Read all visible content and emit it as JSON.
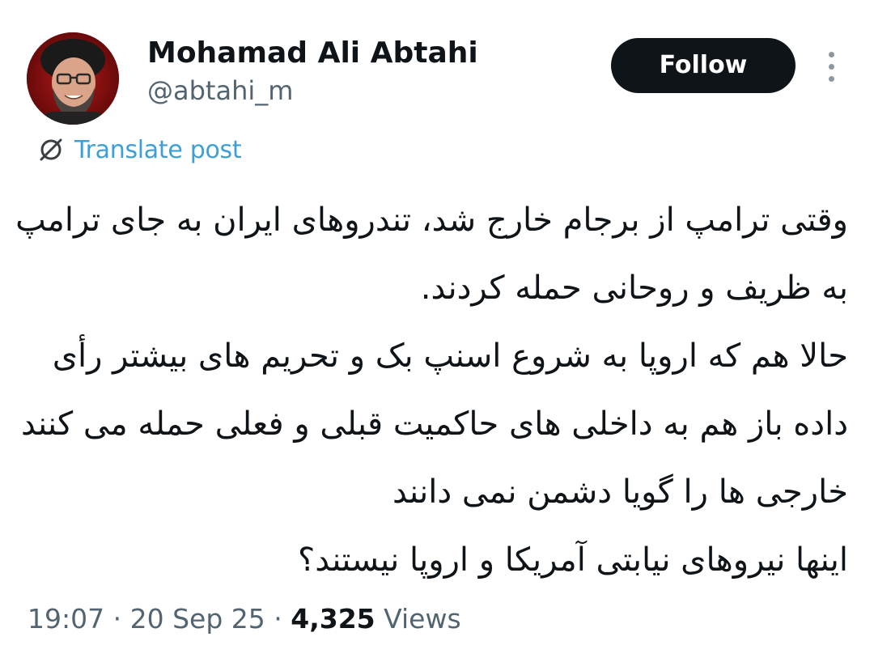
{
  "author": {
    "display_name": "Mohamad Ali Abtahi",
    "handle": "@abtahi_m"
  },
  "follow_label": "Follow",
  "translate_label": "Translate post",
  "tweet_lines": [
    "وقتی ترامپ از برجام خارج شد، تندروهای ایران به جای ترامپ",
    "به ظریف و روحانی حمله کردند.",
    "حالا هم که اروپا به شروع اسنپ بک و تحریم های بیشتر رأی",
    "داده باز هم به داخلی های حاکمیت قبلی و فعلی حمله می کنند",
    "خارجی ها را گویا دشمن نمی دانند",
    "اینها نیروهای نیابتی آمریکا و اروپا نیستند؟"
  ],
  "meta": {
    "time": "19:07",
    "separator_1": " · ",
    "date": "20 Sep 25",
    "separator_2": " · ",
    "views_count": "4,325",
    "views_label": " Views"
  },
  "icons": {
    "avatar": "profile-photo",
    "more": "more-vertical-icon",
    "translate": "globe-slash-icon"
  },
  "colors": {
    "follow_bg": "#0f1419",
    "link": "#3d9fd6",
    "secondary_text": "#536471",
    "avatar_ring": "#7a0a0a"
  }
}
